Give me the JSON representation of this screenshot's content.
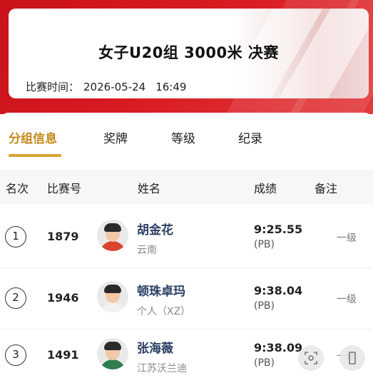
{
  "event": {
    "title": "女子U20组 3000米 决赛",
    "time_label": "比赛时间：",
    "date": "2026-05-24",
    "clock": "16:49"
  },
  "tabs": [
    {
      "label": "分组信息",
      "active": true
    },
    {
      "label": "奖牌",
      "active": false
    },
    {
      "label": "等级",
      "active": false
    },
    {
      "label": "纪录",
      "active": false
    }
  ],
  "table": {
    "headers": {
      "rank": "名次",
      "bib": "比赛号",
      "name": "姓名",
      "result": "成绩",
      "remark": "备注"
    },
    "rows": [
      {
        "rank": "1",
        "bib": "1879",
        "name": "胡金花",
        "team": "云南",
        "result": "9:25.55",
        "note": "(PB)",
        "remark": "一级",
        "jersey": "#d9432f"
      },
      {
        "rank": "2",
        "bib": "1946",
        "name": "顿珠卓玛",
        "team": "个人（XZ）",
        "result": "9:38.04",
        "note": "(PB)",
        "remark": "一级",
        "jersey": "#f2f2f2"
      },
      {
        "rank": "3",
        "bib": "1491",
        "name": "张海薇",
        "team": "江苏沃兰迪",
        "result": "9:38.09",
        "note": "(PB)",
        "remark": "一级",
        "jersey": "#2e7d4f"
      }
    ]
  },
  "colors": {
    "brand_red": "#d71920",
    "active_tab": "#c4891c",
    "name_blue": "#2a3f63"
  }
}
